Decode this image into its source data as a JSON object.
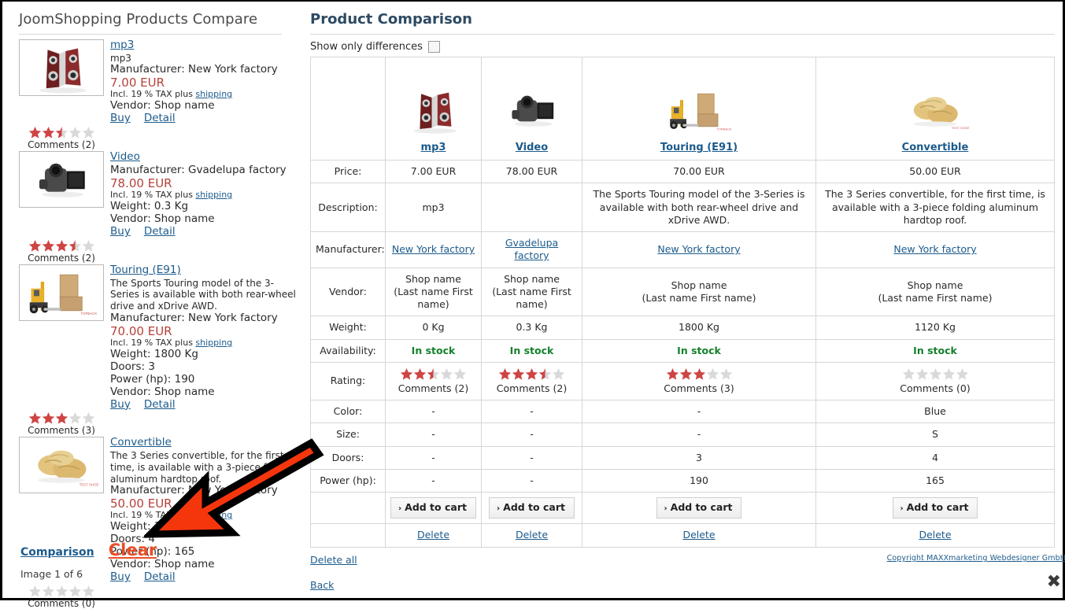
{
  "left": {
    "title": "JoomShopping Products Compare",
    "labels": {
      "manufacturer_prefix": "Manufacturer: ",
      "tax_prefix": "Incl. 19 % TAX plus ",
      "shipping_link": "shipping",
      "vendor_prefix": "Vendor: ",
      "weight_prefix": "Weight: ",
      "doors_prefix": "Doors: ",
      "power_prefix": "Power (hp): ",
      "buy": "Buy",
      "detail": "Detail"
    },
    "products": [
      {
        "name": "mp3",
        "icon": "speakers-thumb",
        "short_desc": "mp3",
        "description": "",
        "manufacturer": "New York factory",
        "price": "7.00 EUR",
        "weight": "",
        "doors": "",
        "power": "",
        "vendor": "Shop name",
        "rating": 2.5,
        "comments": "Comments (2)"
      },
      {
        "name": "Video",
        "icon": "camcorder-thumb",
        "short_desc": "",
        "description": "",
        "manufacturer": "Gvadelupa factory",
        "price": "78.00 EUR",
        "weight": "0.3 Kg",
        "doors": "",
        "power": "",
        "vendor": "Shop name",
        "rating": 3.5,
        "comments": "Comments (2)"
      },
      {
        "name": "Touring (E91)",
        "icon": "forklift-thumb",
        "short_desc": "",
        "description": "The Sports Touring model of the 3-Series is available with both rear-wheel drive and xDrive AWD.",
        "manufacturer": "New York factory",
        "price": "70.00 EUR",
        "weight": "1800 Kg",
        "doors": "3",
        "power": "190",
        "vendor": "Shop name",
        "rating": 3,
        "comments": "Comments (3)"
      },
      {
        "name": "Convertible",
        "icon": "shoes-thumb",
        "short_desc": "",
        "description": "The 3 Series convertible, for the first time, is available with a 3-piece folding aluminum hardtop roof.",
        "manufacturer": "New York factory",
        "price": "50.00 EUR",
        "weight": "1120 Kg",
        "doors": "4",
        "power": "165",
        "vendor": "Shop name",
        "rating": 0,
        "comments": "Comments (0)"
      }
    ],
    "comparison_link": "Comparison",
    "clear_link": "Clear",
    "image_count": "Image 1 of 6"
  },
  "right": {
    "title": "Product Comparison",
    "show_only_differences": "Show only differences",
    "show_only_differences_checked": false,
    "row_labels": [
      "Price:",
      "Description:",
      "Manufacturer:",
      "Vendor:",
      "Weight:",
      "Availability:",
      "Rating:",
      "Color:",
      "Size:",
      "Doors:",
      "Power (hp):"
    ],
    "columns": [
      {
        "name": "mp3",
        "icon": "speakers-thumb",
        "price": "7.00 EUR",
        "description": "mp3",
        "manufacturer": "New York factory",
        "vendor_line1": "Shop name",
        "vendor_line2": "(Last name First name)",
        "weight": "0 Kg",
        "availability": "In stock",
        "rating": 2.5,
        "comments": "Comments (2)",
        "color": "-",
        "size": "-",
        "doors": "-",
        "power": "-",
        "add_to_cart": "Add to cart",
        "delete": "Delete"
      },
      {
        "name": "Video",
        "icon": "camcorder-thumb",
        "price": "78.00 EUR",
        "description": "",
        "manufacturer": "Gvadelupa factory",
        "vendor_line1": "Shop name",
        "vendor_line2": "(Last name First name)",
        "weight": "0.3 Kg",
        "availability": "In stock",
        "rating": 3.5,
        "comments": "Comments (2)",
        "color": "-",
        "size": "-",
        "doors": "-",
        "power": "-",
        "add_to_cart": "Add to cart",
        "delete": "Delete"
      },
      {
        "name": "Touring (E91)",
        "icon": "forklift-thumb",
        "price": "70.00 EUR",
        "description": "The Sports Touring model of the 3-Series is available with both rear-wheel drive and xDrive AWD.",
        "manufacturer": "New York factory",
        "vendor_line1": "Shop name",
        "vendor_line2": "(Last name First name)",
        "weight": "1800 Kg",
        "availability": "In stock",
        "rating": 3,
        "comments": "Comments (3)",
        "color": "-",
        "size": "-",
        "doors": "3",
        "power": "190",
        "add_to_cart": "Add to cart",
        "delete": "Delete"
      },
      {
        "name": "Convertible",
        "icon": "shoes-thumb",
        "price": "50.00 EUR",
        "description": "The 3 Series convertible, for the first time, is available with a 3-piece folding aluminum hardtop roof.",
        "manufacturer": "New York factory",
        "vendor_line1": "Shop name",
        "vendor_line2": "(Last name First name)",
        "weight": "1120 Kg",
        "availability": "In stock",
        "rating": 0,
        "comments": "Comments (0)",
        "color": "Blue",
        "size": "S",
        "doors": "4",
        "power": "165",
        "add_to_cart": "Add to cart",
        "delete": "Delete"
      }
    ],
    "delete_all": "Delete all",
    "back": "Back",
    "copyright": "Copyright MAXXmarketing Webdesigner GmbH",
    "close": "✖"
  },
  "colors": {
    "link": "#1c5b8c",
    "price": "#b5413a",
    "instock": "#15802b",
    "clear": "#e8502a",
    "title": "#2d4a63",
    "star_filled": "#cf4444",
    "star_empty": "#d9d9d9",
    "arrow": "#f5360d"
  }
}
